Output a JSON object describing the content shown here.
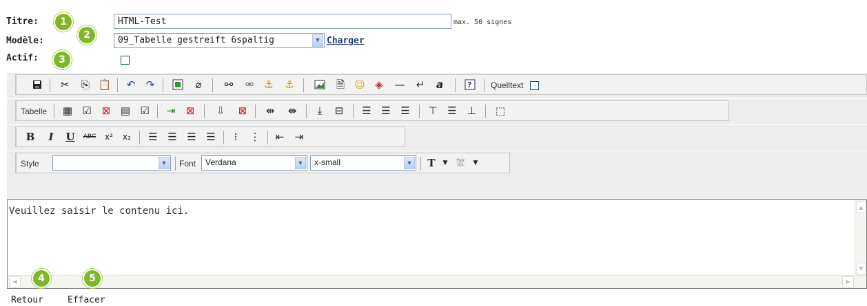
{
  "form": {
    "title_label": "Titre:",
    "title_value": "HTML-Test",
    "title_hint": "max. 50 signes",
    "model_label": "Modèle:",
    "model_value": "09_Tabelle gestreift 6spaltig",
    "load_link": "Charger",
    "active_label": "Actif:"
  },
  "badges": [
    "1",
    "2",
    "3",
    "4",
    "5"
  ],
  "toolbar": {
    "source_label": "Quelltext",
    "table_label": "Tabelle",
    "style_label": "Style",
    "style_value": "",
    "font_label": "Font",
    "font_value": "Verdana",
    "size_value": "x-small"
  },
  "editor": {
    "content": "Veuillez saisir le contenu ici."
  },
  "footer": {
    "back_label": "Retour",
    "clear_label": "Effacer"
  }
}
